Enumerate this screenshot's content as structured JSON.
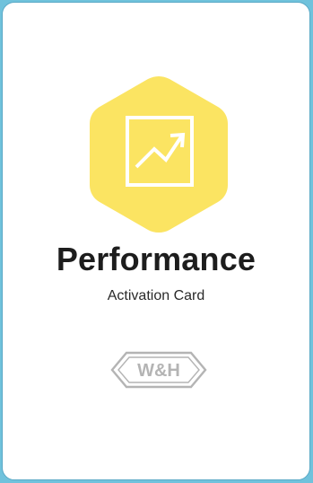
{
  "card": {
    "title": "Performance",
    "subtitle": "Activation Card",
    "logo_text": "W&H",
    "icon": "trending-chart-icon",
    "colors": {
      "background_frame": "#70c2dc",
      "card": "#ffffff",
      "hexagon": "#fbe462",
      "icon_stroke": "#ffffff",
      "text": "#1d1d1d",
      "logo": "#b4b4b4"
    }
  }
}
